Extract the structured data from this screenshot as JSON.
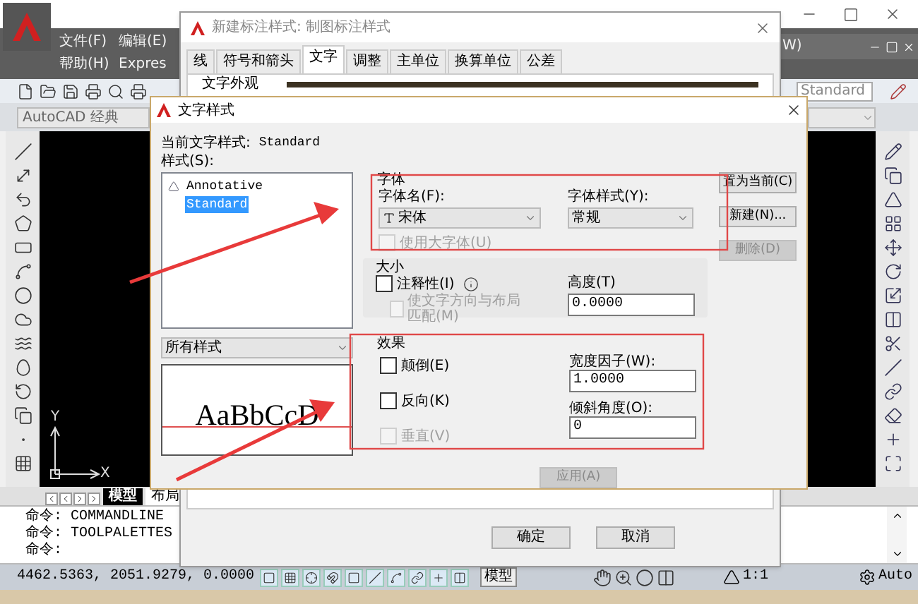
{
  "app": {
    "menu_rows": [
      [
        "文件(F)",
        "编辑(E)"
      ],
      [
        "帮助(H)",
        "Expres"
      ]
    ],
    "menu_tail": "W)",
    "workspace": "AutoCAD 经典",
    "style_dropdown": "Standard",
    "axis": {
      "y": "Y",
      "x": "X"
    },
    "layout_tabs": [
      {
        "label": "模型",
        "selected": true
      },
      {
        "label": "布局",
        "selected": false
      }
    ],
    "command_lines": [
      "命令: COMMANDLINE",
      "命令: TOOLPALETTES"
    ],
    "command_prompt": "命令:",
    "status": {
      "coordinates": "4462.5363, 2051.9279, 0.0000",
      "model": "模型",
      "scale": "1:1",
      "auto": "Auto"
    }
  },
  "dim_dialog": {
    "title": "新建标注样式: 制图标注样式",
    "tabs": [
      {
        "label": "线",
        "selected": false
      },
      {
        "label": "符号和箭头",
        "selected": false
      },
      {
        "label": "文字",
        "selected": true
      },
      {
        "label": "调整",
        "selected": false
      },
      {
        "label": "主单位",
        "selected": false
      },
      {
        "label": "换算单位",
        "selected": false
      },
      {
        "label": "公差",
        "selected": false
      }
    ],
    "group": "文字外观",
    "buttons": [
      "确定",
      "取消"
    ]
  },
  "text_style_dialog": {
    "title": "文字样式",
    "current_label": "当前文字样式:",
    "current_value": "Standard",
    "styles_label": "样式(S):",
    "styles": [
      {
        "name": "Annotative",
        "annotative": true,
        "selected": false
      },
      {
        "name": "Standard",
        "annotative": false,
        "selected": true
      }
    ],
    "filter": "所有样式",
    "preview": "AaBbCcD",
    "font": {
      "title": "字体",
      "name_label": "字体名(F):",
      "name_value": "宋体",
      "style_label": "字体样式(Y):",
      "style_value": "常规",
      "big_font": {
        "label": "使用大字体(U)",
        "checked": false,
        "disabled": true
      }
    },
    "size": {
      "title": "大小",
      "annotative": {
        "label": "注释性(I)",
        "checked": false,
        "disabled": false
      },
      "match": {
        "label": "使文字方向与布局匹配(M)",
        "checked": false,
        "disabled": true
      },
      "height_label": "高度(T)",
      "height_value": "0.0000"
    },
    "effects": {
      "title": "效果",
      "options": [
        {
          "label": "颠倒(E)",
          "checked": false,
          "disabled": false
        },
        {
          "label": "反向(K)",
          "checked": false,
          "disabled": false
        },
        {
          "label": "垂直(V)",
          "checked": false,
          "disabled": true
        }
      ],
      "width_label": "宽度因子(W):",
      "width_value": "1.0000",
      "oblique_label": "倾斜角度(O):",
      "oblique_value": "0"
    },
    "side_buttons": [
      {
        "label": "置为当前(C)",
        "disabled": false
      },
      {
        "label": "新建(N)...",
        "disabled": false
      },
      {
        "label": "删除(D)",
        "disabled": true
      }
    ],
    "apply": {
      "label": "应用(A)",
      "disabled": true
    }
  }
}
